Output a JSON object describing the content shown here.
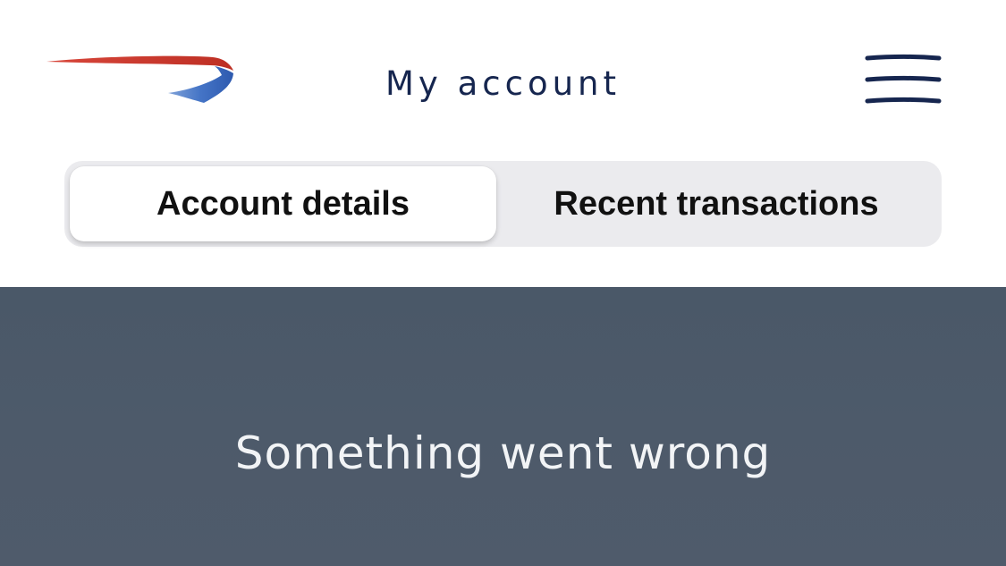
{
  "header": {
    "title": "My account",
    "logo_icon": "speedmarque-logo-icon",
    "menu_icon": "hamburger-menu-icon",
    "title_color": "#16264f"
  },
  "tabs": [
    {
      "label": "Account details",
      "selected": true
    },
    {
      "label": "Recent transactions",
      "selected": false
    }
  ],
  "main": {
    "message": "Something went wrong",
    "background_color": "#4c5968"
  },
  "colors": {
    "logo_red": "#c8372b",
    "logo_blue": "#3f6fc4",
    "tab_track": "#ebebee"
  }
}
